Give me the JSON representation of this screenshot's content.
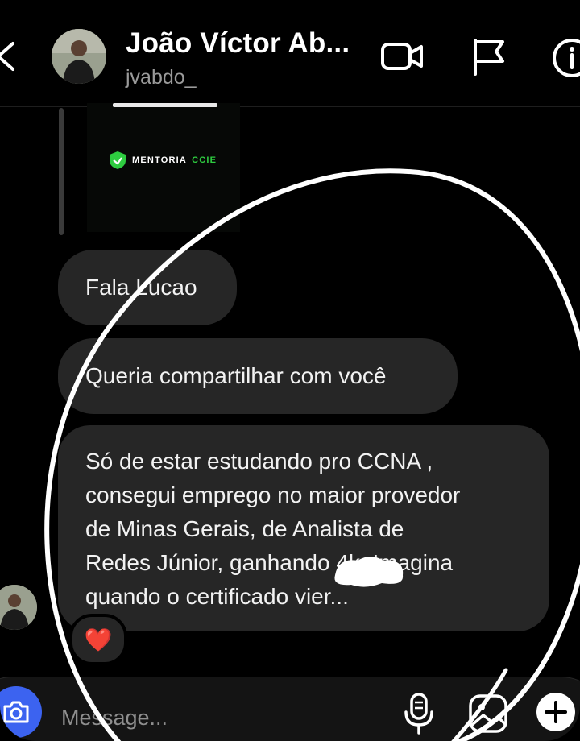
{
  "header": {
    "name": "João Víctor Ab...",
    "username": "jvabdo_",
    "icons": [
      "back-chevron-icon",
      "video-camera-icon",
      "flag-icon",
      "info-icon"
    ]
  },
  "shared_post": {
    "logo_text_main": "MENTORIA",
    "logo_text_accent": "CCIE"
  },
  "messages": [
    {
      "text": "Fala Lucao"
    },
    {
      "text": "Queria compartilhar com você"
    },
    {
      "text": "Só de estar estudando pro CCNA ,\nconsegui emprego no maior provedor\nde Minas Gerais, de Analista de\nRedes Júnior, ganhando 4k. Imagina\nquando o certificado vier..."
    }
  ],
  "reaction": {
    "emoji": "❤️"
  },
  "composer": {
    "placeholder": "Message...",
    "icons": [
      "camera-icon",
      "microphone-icon",
      "gallery-icon",
      "plus-icon"
    ]
  },
  "colors": {
    "background": "#000000",
    "bubble": "#262626",
    "camera_button": "#3c63f0",
    "accent_green": "#2ecc40",
    "annotation": "#ffffff"
  }
}
